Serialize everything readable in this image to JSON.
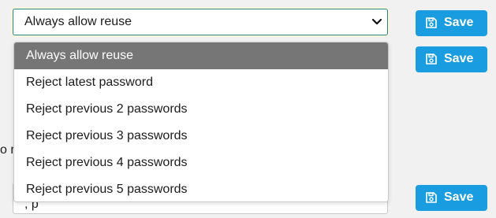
{
  "password_reuse": {
    "selected": "Always allow reuse",
    "options": [
      "Always allow reuse",
      "Reject latest password",
      "Reject previous 2 passwords",
      "Reject previous 3 passwords",
      "Reject previous 4 passwords",
      "Reject previous 5 passwords"
    ]
  },
  "save_label": "Save",
  "partial_label": "o r",
  "partial_field_text": ", p",
  "icons": {
    "chevron": "chevron-down-icon",
    "save": "floppy-disk-icon"
  },
  "colors": {
    "button": "#1a9de0",
    "selected_option": "#767676",
    "select_border": "#1e8a8a"
  }
}
